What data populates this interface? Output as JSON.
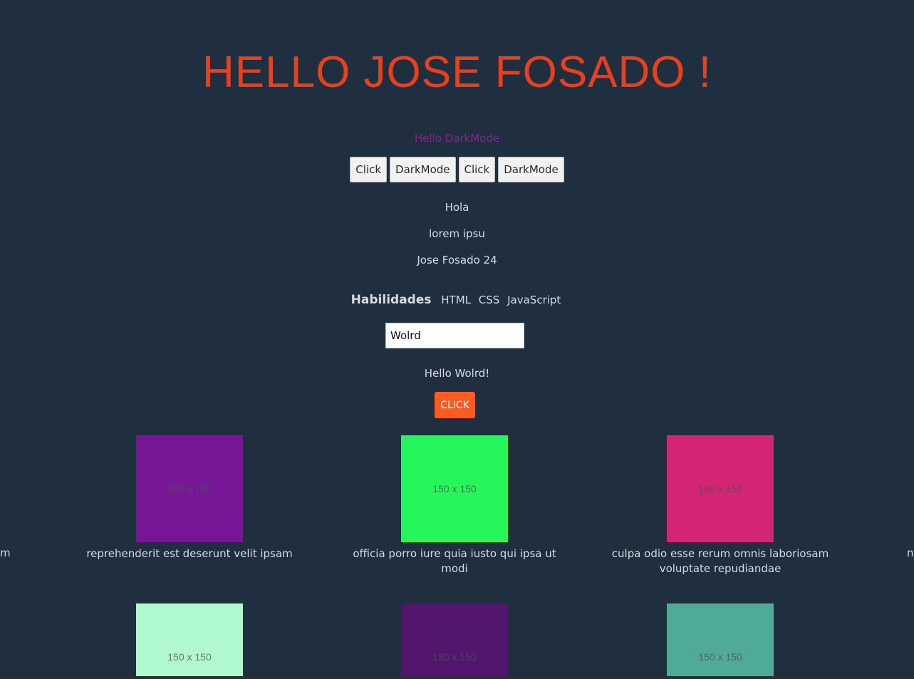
{
  "header": {
    "title": "HELLO JOSE FOSADO !",
    "subtitle": "Hello DarkMode"
  },
  "buttons": [
    {
      "label": "Click"
    },
    {
      "label": "DarkMode"
    },
    {
      "label": "Click"
    },
    {
      "label": "DarkMode"
    }
  ],
  "texts": {
    "hola": "Hola",
    "lorem": "lorem ipsu",
    "name_age": "Jose Fosado 24"
  },
  "skills": {
    "title": "Habilidades",
    "items": [
      "HTML",
      "CSS",
      "JavaScript"
    ]
  },
  "input": {
    "value": "Wolrd"
  },
  "greeting": "Hello Wolrd!",
  "action_button": {
    "label": "CLICK",
    "color": "#ff5a1f"
  },
  "colors": {
    "background": "#1f2f3f",
    "title": "#e8401c",
    "subtitle": "#7a2a8c"
  },
  "edge_fragments": {
    "left": "m",
    "right": "n"
  },
  "cards": [
    {
      "placeholder": "150 x 150",
      "color": "#771796",
      "caption": "reprehenderit est deserunt velit ipsam"
    },
    {
      "placeholder": "150 x 150",
      "color": "#24f65b",
      "caption": "officia porro iure quia iusto qui ipsa ut modi"
    },
    {
      "placeholder": "150 x 150",
      "color": "#d32574",
      "caption": "culpa odio esse rerum omnis laboriosam voluptate repudiandae"
    },
    {
      "placeholder": "150 x 150",
      "color": "#b0f8cd",
      "caption": ""
    },
    {
      "placeholder": "150 x 150",
      "color": "#53166d",
      "caption": ""
    },
    {
      "placeholder": "150 x 150",
      "color": "#50aa98",
      "caption": ""
    }
  ]
}
